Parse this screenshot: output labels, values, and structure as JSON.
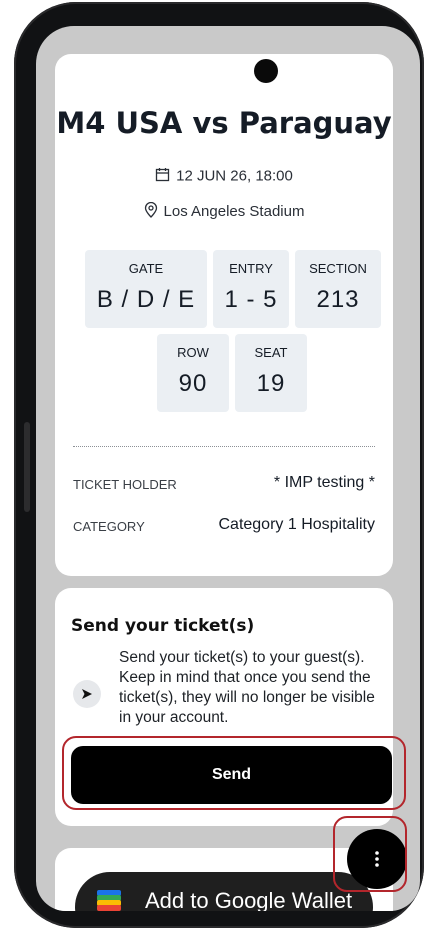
{
  "ticket": {
    "match_title": "M4 USA vs Paraguay",
    "date": "12 JUN 26, 18:00",
    "venue": "Los Angeles Stadium",
    "gate_label": "GATE",
    "gate_value": "B / D / E",
    "entry_label": "ENTRY",
    "entry_value": "1 - 5",
    "section_label": "SECTION",
    "section_value": "213",
    "row_label": "ROW",
    "row_value": "90",
    "seat_label": "SEAT",
    "seat_value": "19",
    "holder_label": "TICKET HOLDER",
    "holder_value": "* IMP testing  *",
    "category_label": "CATEGORY",
    "category_value": "Category 1 Hospitality"
  },
  "send": {
    "heading": "Send your ticket(s)",
    "description": "Send your ticket(s) to your guest(s). Keep in mind that once you send the ticket(s), they will no longer be visible in your account.",
    "button_label": "Send"
  },
  "wallet": {
    "button_label": "Add to Google Wallet"
  },
  "fab": {
    "icon": "more-vertical-icon"
  },
  "colors": {
    "highlight": "#b3262c",
    "primary_button": "#000000",
    "info_box": "#ebeff3"
  }
}
